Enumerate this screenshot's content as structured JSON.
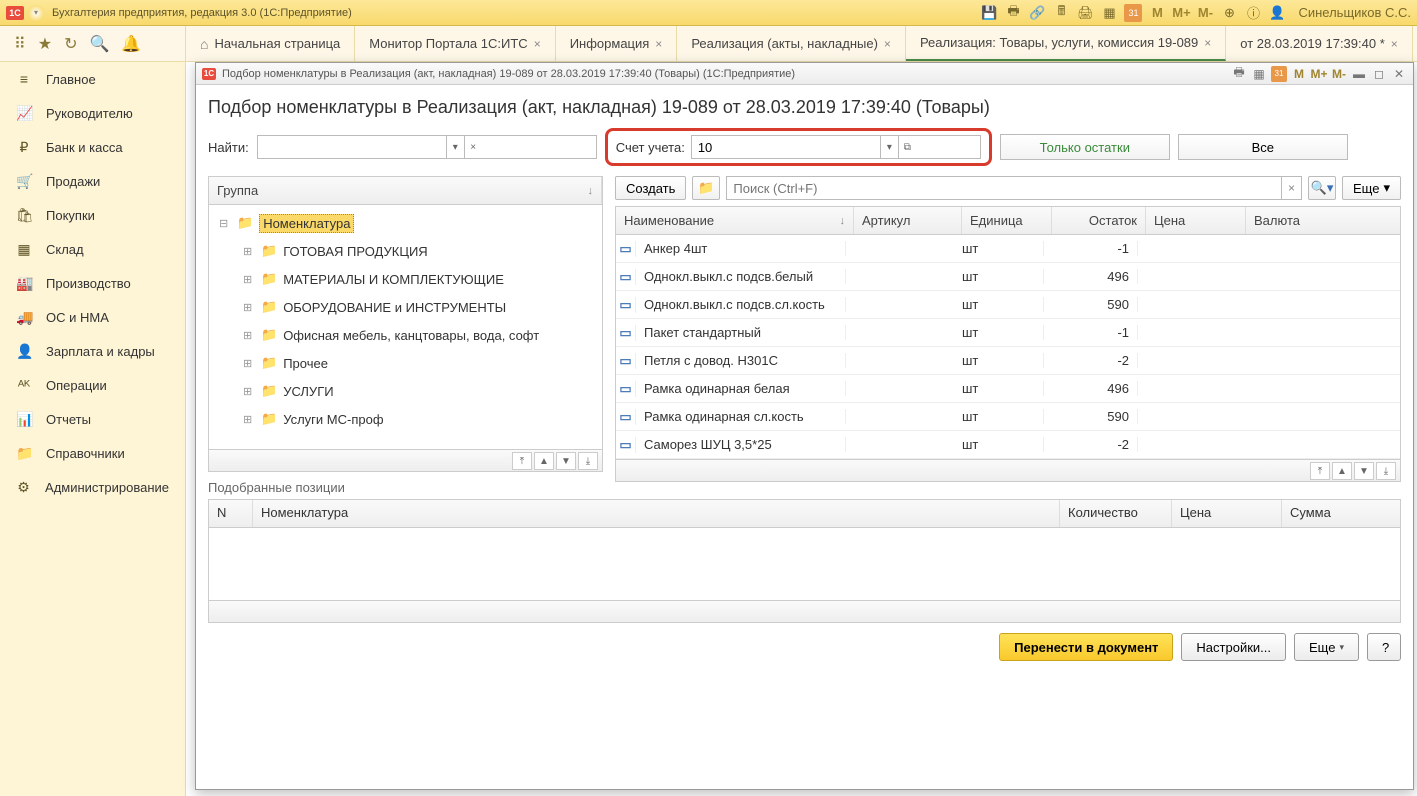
{
  "titlebar": {
    "appTitle": "Бухгалтерия предприятия, редакция 3.0  (1С:Предприятие)",
    "user": "Синельщиков С.С.",
    "m": "M",
    "mplus": "M+",
    "mminus": "M-"
  },
  "tabs": [
    {
      "label": "Начальная страница",
      "home": true
    },
    {
      "label": "Монитор Портала 1С:ИТС",
      "close": true
    },
    {
      "label": "Информация",
      "close": true
    },
    {
      "label": "Реализация (акты, накладные)",
      "close": true
    },
    {
      "label": "Реализация: Товары, услуги, комиссия 19-089",
      "close": true,
      "active": true
    },
    {
      "label": "от 28.03.2019 17:39:40 *",
      "close": true
    }
  ],
  "sidebar": [
    {
      "icon": "≡",
      "label": "Главное"
    },
    {
      "icon": "📈",
      "label": "Руководителю"
    },
    {
      "icon": "₽",
      "label": "Банк и касса"
    },
    {
      "icon": "🛒",
      "label": "Продажи"
    },
    {
      "icon": "🛍",
      "label": "Покупки"
    },
    {
      "icon": "▦",
      "label": "Склад"
    },
    {
      "icon": "🏭",
      "label": "Производство"
    },
    {
      "icon": "🚚",
      "label": "ОС и НМА"
    },
    {
      "icon": "👤",
      "label": "Зарплата и кадры"
    },
    {
      "icon": "ᴬᴷ",
      "label": "Операции"
    },
    {
      "icon": "📊",
      "label": "Отчеты"
    },
    {
      "icon": "📁",
      "label": "Справочники"
    },
    {
      "icon": "⚙",
      "label": "Администрирование"
    }
  ],
  "modal": {
    "title": "Подбор номенклатуры в Реализация (акт, накладная) 19-089 от 28.03.2019 17:39:40 (Товары)   (1С:Предприятие)",
    "heading": "Подбор номенклатуры в Реализация (акт, накладная) 19-089 от 28.03.2019 17:39:40 (Товары)",
    "find_label": "Найти:",
    "account_label": "Счет учета:",
    "account_value": "10",
    "only_remains": "Только остатки",
    "all": "Все",
    "group_header": "Группа",
    "tree": [
      {
        "label": "Номенклатура",
        "selected": true
      },
      {
        "label": "ГОТОВАЯ ПРОДУКЦИЯ",
        "child": true
      },
      {
        "label": "МАТЕРИАЛЫ И КОМПЛЕКТУЮЩИЕ",
        "child": true
      },
      {
        "label": "ОБОРУДОВАНИЕ и ИНСТРУМЕНТЫ",
        "child": true
      },
      {
        "label": "Офисная мебель, канцтовары, вода, софт",
        "child": true
      },
      {
        "label": "Прочее",
        "child": true
      },
      {
        "label": "УСЛУГИ",
        "child": true
      },
      {
        "label": "Услуги МС-проф",
        "child": true
      }
    ],
    "create_btn": "Создать",
    "search_placeholder": "Поиск (Ctrl+F)",
    "more_btn": "Еще",
    "cols": {
      "name": "Наименование",
      "art": "Артикул",
      "unit": "Единица",
      "rest": "Остаток",
      "price": "Цена",
      "curr": "Валюта"
    },
    "rows": [
      {
        "name": "Анкер 4шт",
        "unit": "шт",
        "rest": "-1"
      },
      {
        "name": "Однокл.выкл.с подсв.белый",
        "unit": "шт",
        "rest": "496"
      },
      {
        "name": "Однокл.выкл.с подсв.сл.кость",
        "unit": "шт",
        "rest": "590"
      },
      {
        "name": "Пакет стандартный",
        "unit": "шт",
        "rest": "-1"
      },
      {
        "name": "Петля с довод. H301C",
        "unit": "шт",
        "rest": "-2"
      },
      {
        "name": "Рамка одинарная белая",
        "unit": "шт",
        "rest": "496"
      },
      {
        "name": "Рамка одинарная сл.кость",
        "unit": "шт",
        "rest": "590"
      },
      {
        "name": "Саморез ШУЦ 3,5*25",
        "unit": "шт",
        "rest": "-2"
      }
    ],
    "picked_label": "Подобранные позиции",
    "picked_cols": {
      "n": "N",
      "nom": "Номенклатура",
      "qty": "Количество",
      "price": "Цена",
      "sum": "Сумма"
    },
    "transfer_btn": "Перенести в документ",
    "settings_btn": "Настройки...",
    "more2_btn": "Еще",
    "help_btn": "?"
  }
}
